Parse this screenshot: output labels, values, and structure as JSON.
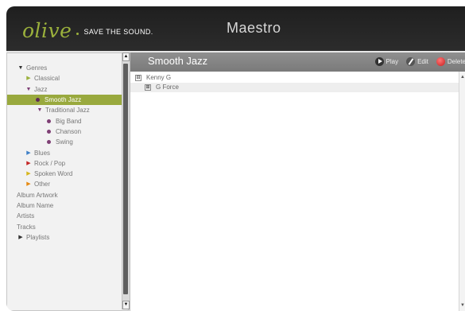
{
  "header": {
    "logo": {
      "word": "olive",
      "tagline": "SAVE THE SOUND."
    },
    "title": "Maestro"
  },
  "sidebar": {
    "items": [
      {
        "label": "Genres",
        "tri": "▼",
        "tri_color": "black",
        "indent": 0
      },
      {
        "label": "Classical",
        "tri": "▶",
        "tri_color": "olive",
        "indent": 1
      },
      {
        "label": "Jazz",
        "tri": "▼",
        "tri_color": "purple",
        "indent": 1
      },
      {
        "label": "Smooth Jazz",
        "dot": true,
        "indent": 2,
        "selected": true
      },
      {
        "label": "Traditional Jazz",
        "tri": "▼",
        "tri_color": "purple",
        "indent": 2
      },
      {
        "label": "Big Band",
        "dot": true,
        "indent": 3
      },
      {
        "label": "Chanson",
        "dot": true,
        "indent": 3
      },
      {
        "label": "Swing",
        "dot": true,
        "indent": 3
      },
      {
        "label": "Blues",
        "tri": "▶",
        "tri_color": "blue",
        "indent": 1
      },
      {
        "label": "Rock / Pop",
        "tri": "▶",
        "tri_color": "red",
        "indent": 1
      },
      {
        "label": "Spoken Word",
        "tri": "▶",
        "tri_color": "yellow",
        "indent": 1
      },
      {
        "label": "Other",
        "tri": "▶",
        "tri_color": "orange",
        "indent": 1
      },
      {
        "label": "Album Artwork",
        "indent": 0
      },
      {
        "label": "Album Name",
        "indent": 0
      },
      {
        "label": "Artists",
        "indent": 0
      },
      {
        "label": "Tracks",
        "indent": 0
      },
      {
        "label": "Playlists",
        "tri": "▶",
        "tri_color": "black",
        "indent": 0
      }
    ]
  },
  "main": {
    "title": "Smooth Jazz",
    "actions": {
      "play": "Play",
      "edit": "Edit",
      "delete": "Delete"
    },
    "list": [
      {
        "label": "Kenny G",
        "expander": "⊟",
        "level": 0
      },
      {
        "label": "G Force",
        "expander": "⊞",
        "level": 1
      }
    ]
  },
  "icons": {
    "play": "play-icon",
    "edit": "edit-icon",
    "delete": "delete-icon"
  },
  "colors": {
    "brand": "#9bb13c",
    "selection": "#99a93e"
  }
}
